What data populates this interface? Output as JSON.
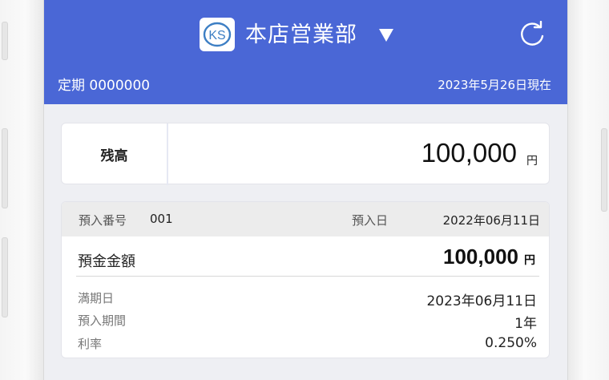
{
  "header": {
    "logo_text": "KS",
    "branch_name": "本店営業部",
    "account_label": "定期 0000000",
    "as_of_date": "2023年5月26日現在"
  },
  "balance": {
    "label": "残高",
    "amount": "100,000",
    "unit": "円"
  },
  "deposit": {
    "number_label": "預入番号",
    "number_value": "001",
    "date_label": "預入日",
    "date_value": "2022年06月11日",
    "amount_label": "預金金額",
    "amount_value": "100,000",
    "amount_unit": "円",
    "details": [
      {
        "label": "満期日",
        "value": "2023年06月11日"
      },
      {
        "label": "預入期間",
        "value": "1年"
      },
      {
        "label": "利率",
        "value": "0.250%"
      }
    ]
  },
  "colors": {
    "header_bg": "#4a67d6",
    "screen_bg": "#eeeff3",
    "logo_blue": "#3d7fc4"
  },
  "icons": {
    "dropdown": "caret-down-icon",
    "refresh": "refresh-icon"
  }
}
